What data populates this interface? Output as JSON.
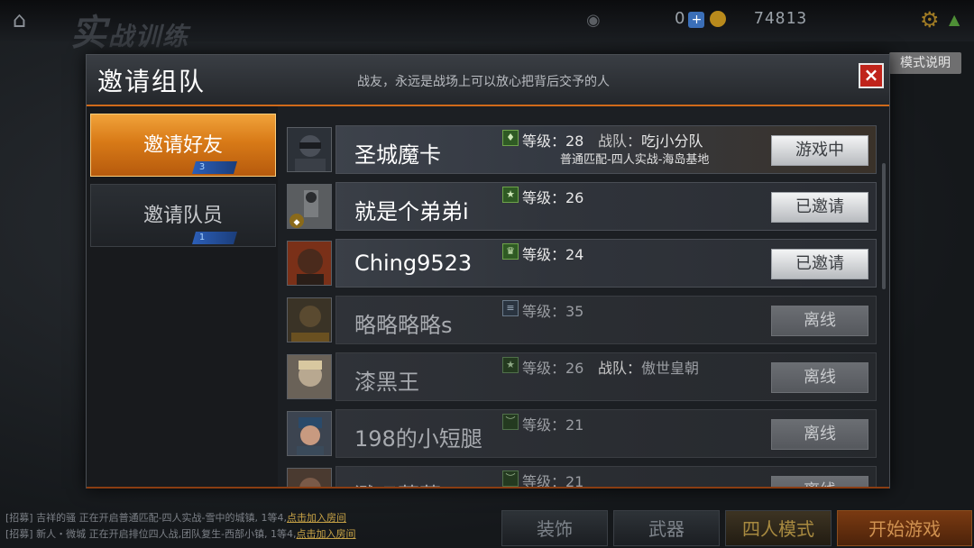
{
  "background": {
    "title_main": "实",
    "title_sub": "战训练",
    "currency_count": "0",
    "money": "74813",
    "mode_tag": "模式说明",
    "chat": [
      {
        "prefix": "[招募] 吉祥的骚",
        "text": "正在开启普通匹配-四人实战-雪中的城镇, 1等4,",
        "link": "点击加入房间"
      },
      {
        "prefix": "[招募] 新人・微城",
        "text": "正在开启排位四人战,团队复生-西部小镇, 1等4,",
        "link": "点击加入房间"
      }
    ],
    "buttons": {
      "decorate": "装饰",
      "weapon": "武器",
      "mode": "四人模式",
      "start": "开始游戏"
    }
  },
  "modal": {
    "title": "邀请组队",
    "subtitle": "战友，永远是战场上可以放心把背后交予的人",
    "close_label": "×",
    "tabs": [
      {
        "label": "邀请好友",
        "badge": "3"
      },
      {
        "label": "邀请队员",
        "badge": "1"
      }
    ],
    "friends": [
      {
        "name": "圣城魔卡",
        "level_label": "等级：28",
        "team_label": "战队：",
        "team": "吃j小分队",
        "status": "普通匹配-四人实战-海岛基地",
        "action": "游戏中",
        "online": true
      },
      {
        "name": "就是个弟弟i",
        "level_label": "等级：26",
        "team_label": "",
        "team": "",
        "status": "",
        "action": "已邀请",
        "online": true
      },
      {
        "name": "Ching9523",
        "level_label": "等级：24",
        "team_label": "",
        "team": "",
        "status": "",
        "action": "已邀请",
        "online": true
      },
      {
        "name": "略略略略s",
        "level_label": "等级：35",
        "team_label": "",
        "team": "",
        "status": "",
        "action": "离线",
        "online": false
      },
      {
        "name": "漆黑王",
        "level_label": "等级：26",
        "team_label": "战队：",
        "team": "傲世皇朝",
        "status": "",
        "action": "离线",
        "online": false
      },
      {
        "name": "198的小短腿",
        "level_label": "等级：21",
        "team_label": "",
        "team": "",
        "status": "",
        "action": "离线",
        "online": false
      },
      {
        "name": "溅叹蔡蔡",
        "level_label": "等级：21",
        "team_label": "",
        "team": "",
        "status": "",
        "action": "离线",
        "online": false
      }
    ]
  }
}
